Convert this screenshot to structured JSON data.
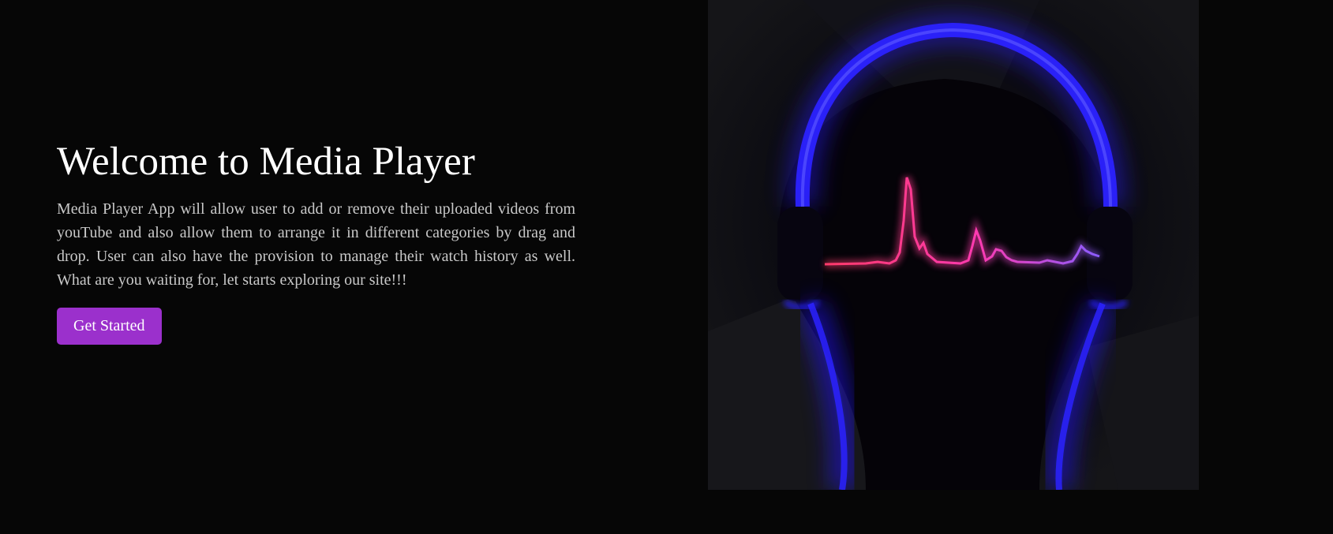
{
  "hero": {
    "title": "Welcome to Media Player",
    "description": "Media Player App will allow user to add or remove their uploaded videos from youTube and also allow them to arrange it in different categories by drag and drop. User can also have the provision to manage their watch history as well. What are you waiting for, let starts exploring our site!!!",
    "cta_label": "Get Started"
  },
  "illustration": {
    "icon": "headphones-waveform-image",
    "glow_color": "#2a1cff",
    "wave_color": "#ff3aa0",
    "wave_end_color": "#8a5cff"
  }
}
